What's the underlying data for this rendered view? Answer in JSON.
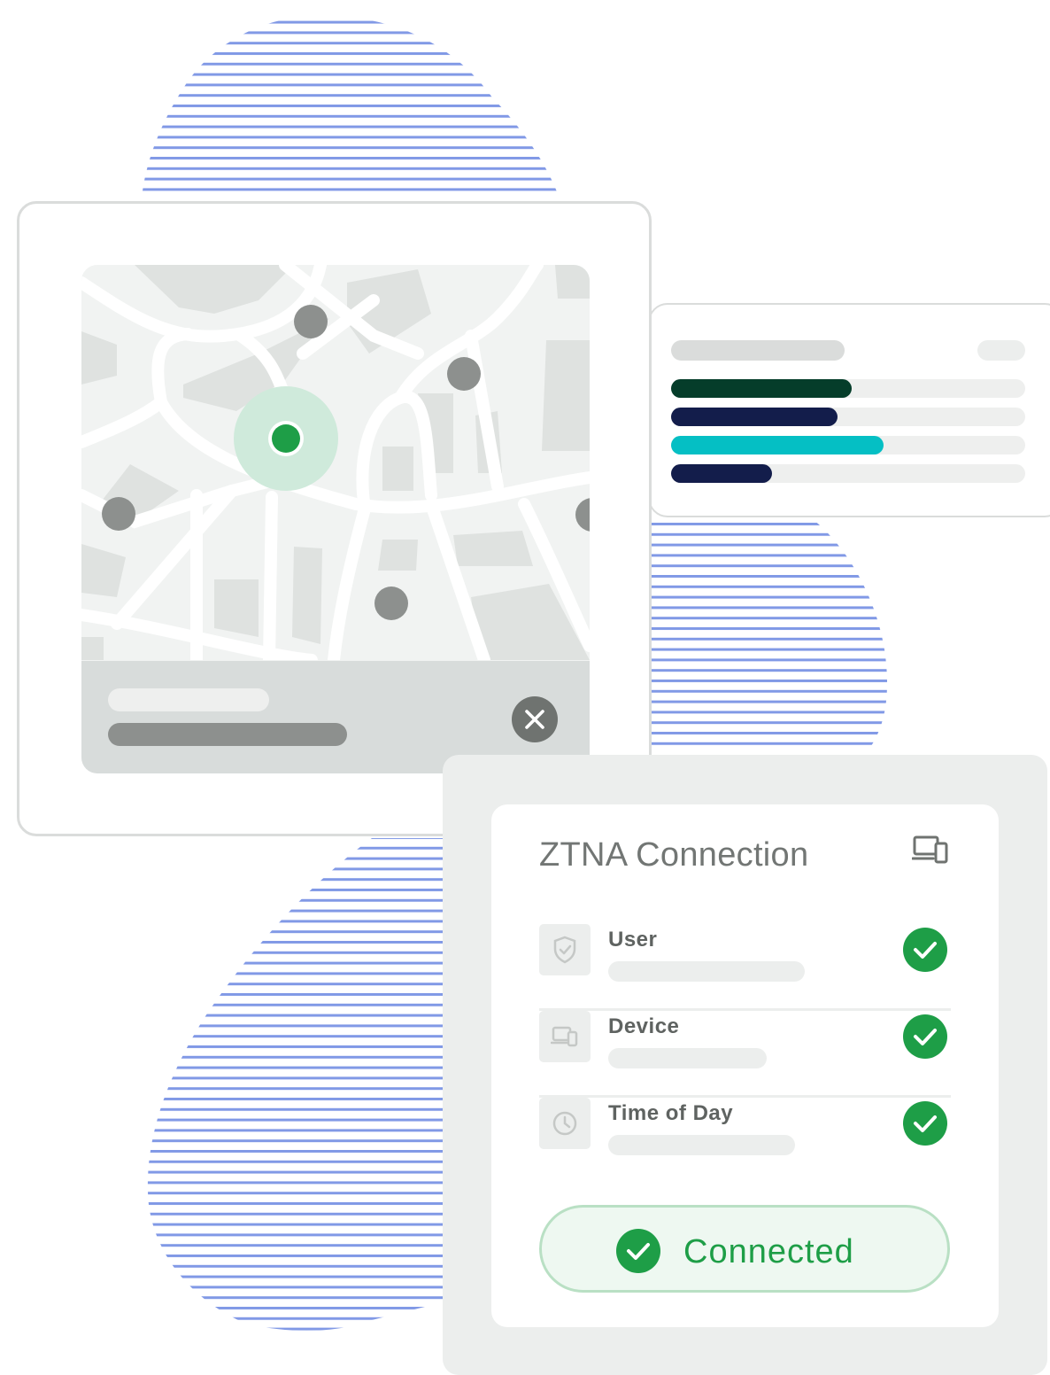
{
  "colors": {
    "stripe": "#8199e6",
    "card_border": "#dadcdb",
    "map_road": "#ffffff",
    "map_block": "#dfe2e0",
    "marker_gray": "#8d908e",
    "location_dot": "#1e9e47",
    "location_halo": "#cfeadb",
    "bar_dark_green": "#053d2a",
    "bar_navy": "#131d4b",
    "bar_teal": "#05bfc4",
    "success_green": "#1e9e47"
  },
  "bars_card": {
    "bars": [
      {
        "name": "bar-1",
        "color": "#053d2a",
        "fraction": 0.51
      },
      {
        "name": "bar-2",
        "color": "#131d4b",
        "fraction": 0.47
      },
      {
        "name": "bar-3",
        "color": "#05bfc4",
        "fraction": 0.6
      },
      {
        "name": "bar-4",
        "color": "#131d4b",
        "fraction": 0.285
      }
    ]
  },
  "map_card": {
    "close_icon": "close-icon"
  },
  "ztna": {
    "title": "ZTNA Connection",
    "header_icon": "devices-icon",
    "checks": [
      {
        "label": "User",
        "icon": "shield-check-icon",
        "status": "passed"
      },
      {
        "label": "Device",
        "icon": "devices-icon",
        "status": "passed"
      },
      {
        "label": "Time of Day",
        "icon": "clock-icon",
        "status": "passed"
      }
    ],
    "status_label": "Connected"
  }
}
